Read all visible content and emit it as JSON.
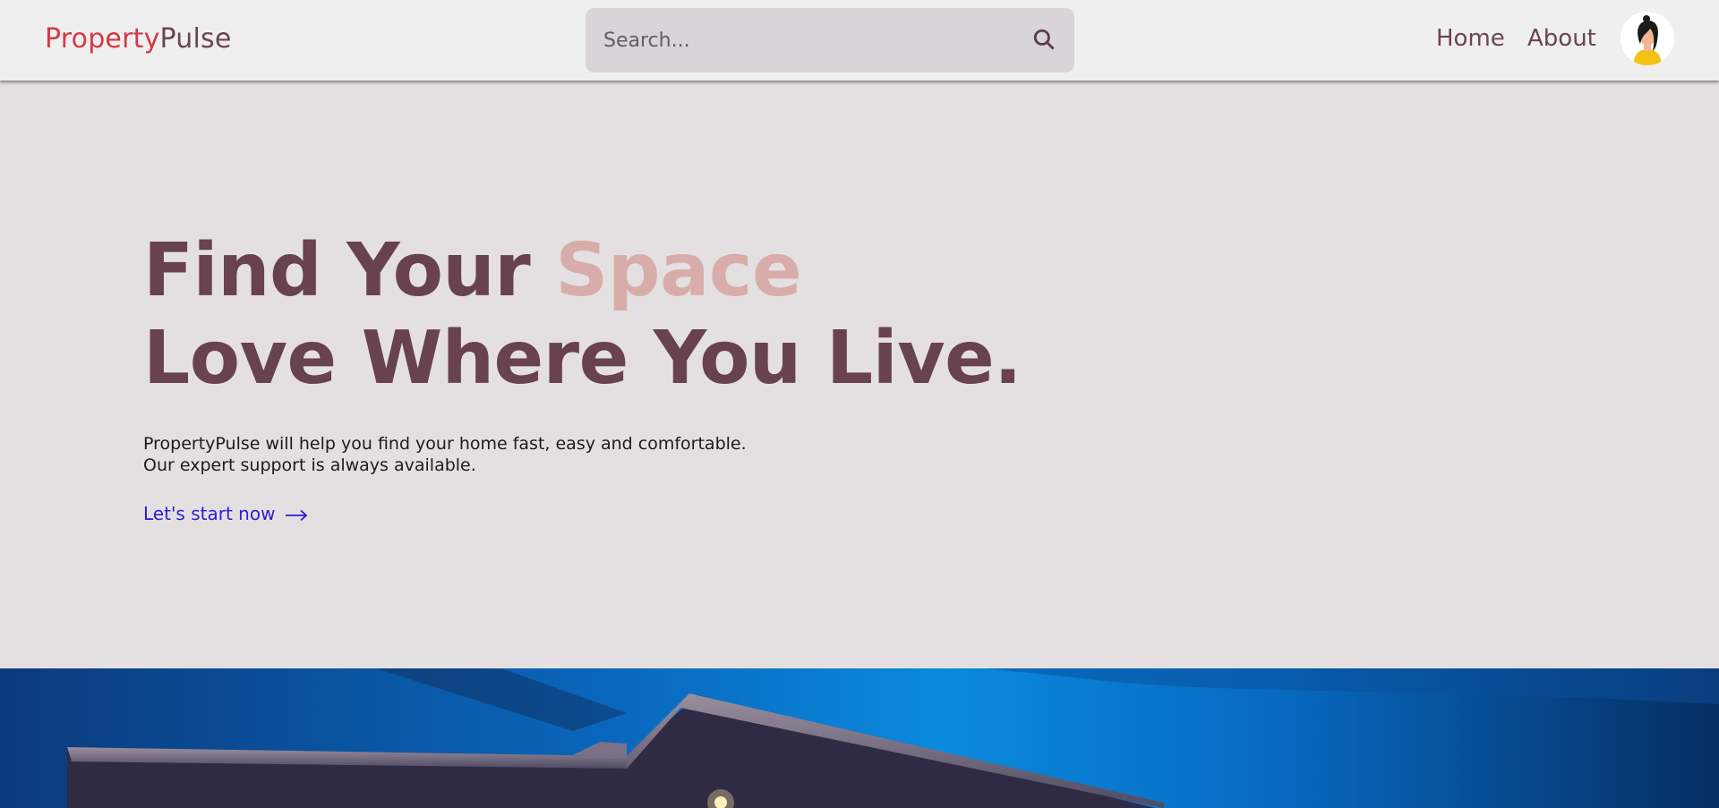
{
  "navbar": {
    "logo": {
      "part1": "Property",
      "part2": "Pulse",
      "color1": "#d33a45",
      "color2": "#6b4553"
    },
    "search": {
      "placeholder": "Search...",
      "value": "",
      "icon": "search-icon"
    },
    "links": [
      {
        "label": "Home"
      },
      {
        "label": "About"
      }
    ],
    "avatar": {
      "icon": "user-avatar-icon"
    }
  },
  "hero": {
    "title_line1_start": "Find Your ",
    "title_line1_accent": "Space",
    "title_line2": "Love Where You Live.",
    "description_line1": "PropertyPulse will help you find your home fast, easy and comfortable.",
    "description_line2": "Our expert support is always available.",
    "cta_label": "Let's start now",
    "cta_icon": "arrow-right-icon",
    "colors": {
      "title": "#68424f",
      "accent": "#d8ada9",
      "cta": "#2a1fd6"
    }
  },
  "banner": {
    "image": "house-exterior-night-sky"
  }
}
